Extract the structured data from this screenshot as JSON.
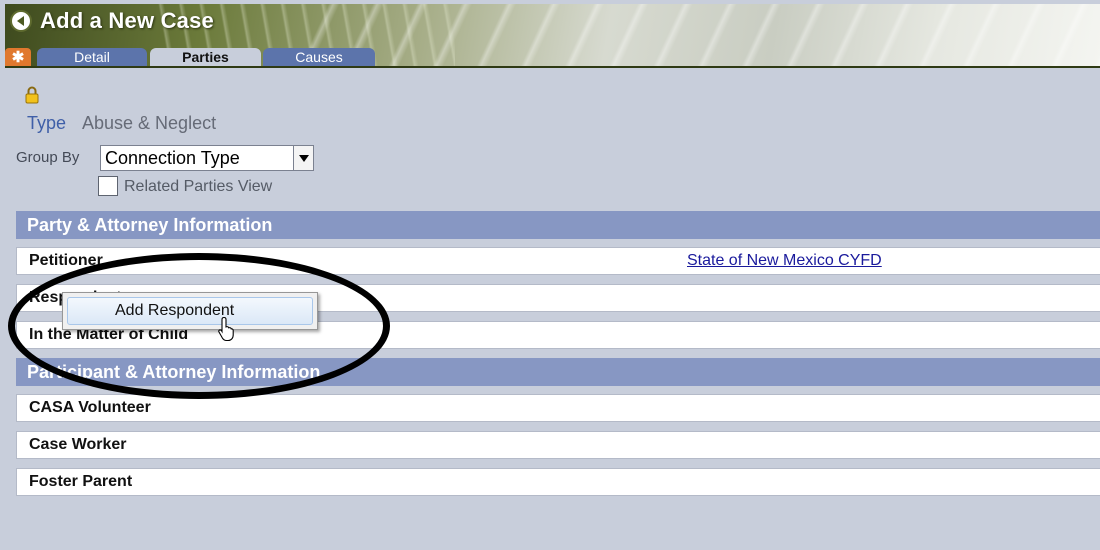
{
  "header": {
    "title": "Add a New Case",
    "back_icon": "back-arrow-icon"
  },
  "tabs": [
    {
      "label": "Detail",
      "active": false
    },
    {
      "label": "Parties",
      "active": true
    },
    {
      "label": "Causes",
      "active": false
    }
  ],
  "star_tab_symbol": "✱",
  "case_type": {
    "label": "Type",
    "value": "Abuse & Neglect"
  },
  "group_by": {
    "label": "Group By",
    "selected": "Connection Type"
  },
  "related_parties": {
    "label": "Related Parties View",
    "checked": false
  },
  "party_section": {
    "title": "Party & Attorney Information",
    "rows": [
      {
        "label": "Petitioner",
        "link": "State of New Mexico CYFD"
      },
      {
        "label": "Respondent"
      },
      {
        "label": "In the Matter of Child"
      }
    ]
  },
  "participant_section": {
    "title": "Participant & Attorney Information",
    "rows": [
      {
        "label": "CASA Volunteer"
      },
      {
        "label": "Case Worker"
      },
      {
        "label": "Foster Parent"
      }
    ]
  },
  "context_menu": {
    "item": "Add Respondent"
  },
  "colors": {
    "tab_inactive": "#5c74ab",
    "section_header": "#8797c3",
    "link": "#1a1a9c",
    "type_label": "#3f5fa8"
  }
}
